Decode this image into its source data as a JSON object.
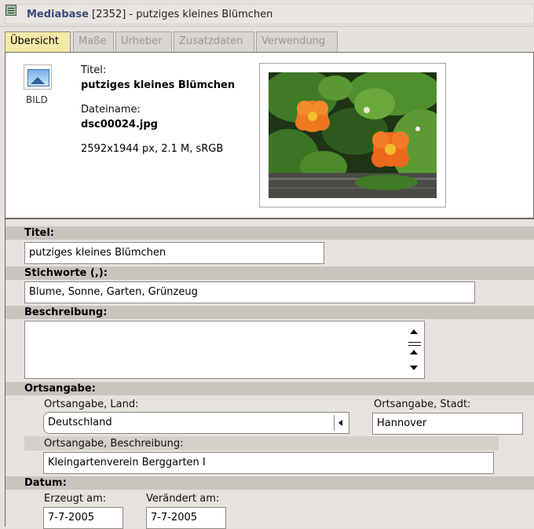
{
  "window": {
    "app_name": "Mediabase",
    "title_rest": " [2352] - putziges kleines Blümchen"
  },
  "tabs": [
    {
      "label": "Übersicht",
      "active": true
    },
    {
      "label": "Maße",
      "active": false
    },
    {
      "label": "Urheber",
      "active": false
    },
    {
      "label": "Zusatzdaten",
      "active": false
    },
    {
      "label": "Verwendung",
      "active": false
    }
  ],
  "overview": {
    "type_icon": "image-file-icon",
    "type_label": "BILD",
    "title_label": "Titel:",
    "title_value": "putziges kleines Blümchen",
    "filename_label": "Dateiname:",
    "filename_value": "dsc00024.jpg",
    "specs": "2592x1944 px, 2.1 M, sRGB"
  },
  "form": {
    "titel": {
      "label": "Titel:",
      "value": "putziges kleines Blümchen"
    },
    "stichworte": {
      "label": "Stichworte (,):",
      "value": "Blume, Sonne, Garten, Grünzeug"
    },
    "beschreibung": {
      "label": "Beschreibung:",
      "value": ""
    },
    "ortsangabe": {
      "label": "Ortsangabe:",
      "land_label": "Ortsangabe, Land:",
      "land_value": "Deutschland",
      "stadt_label": "Ortsangabe, Stadt:",
      "stadt_value": "Hannover",
      "beschreibung_label": "Ortsangabe, Beschreibung:",
      "beschreibung_value": "Kleingartenverein Berggarten I"
    },
    "datum": {
      "label": "Datum:",
      "erzeugt_label": "Erzeugt am:",
      "erzeugt_value": "7-7-2005",
      "veraendert_label": "Verändert am:",
      "veraendert_value": "7-7-2005"
    }
  },
  "colors": {
    "active_tab": "#f4e9a8",
    "band": "#c8c4be",
    "panel": "#e6e3de",
    "title_accent": "#3a4a7a"
  }
}
